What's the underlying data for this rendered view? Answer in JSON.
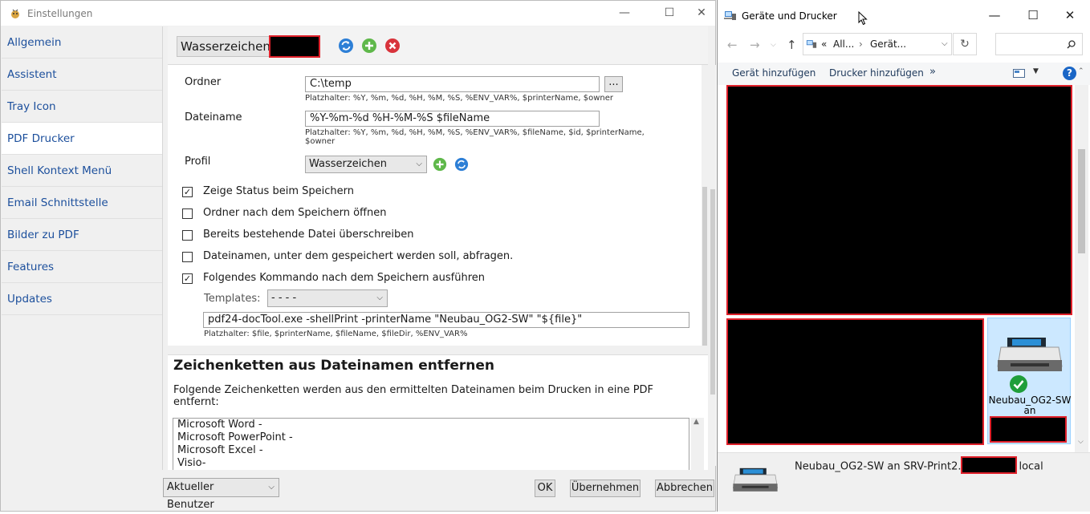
{
  "left_window": {
    "title": "Einstellungen",
    "sidebar": [
      {
        "label": "Allgemein"
      },
      {
        "label": "Assistent"
      },
      {
        "label": "Tray Icon"
      },
      {
        "label": "PDF Drucker",
        "active": true
      },
      {
        "label": "Shell Kontext Menü"
      },
      {
        "label": "Email Schnittstelle"
      },
      {
        "label": "Bilder zu PDF"
      },
      {
        "label": "Features"
      },
      {
        "label": "Updates"
      }
    ],
    "header": {
      "profile_name": "Wasserzeichen"
    },
    "form": {
      "folder_label": "Ordner",
      "folder_value": "C:\\temp",
      "folder_browse": "...",
      "folder_hint": "Platzhalter: %Y, %m, %d, %H, %M, %S, %ENV_VAR%, $printerName, $owner",
      "filename_label": "Dateiname",
      "filename_value": "%Y-%m-%d %H-%M-%S $fileName",
      "filename_hint_1": "Platzhalter: %Y, %m, %d, %H, %M, %S, %ENV_VAR%, $fileName, $id, $printerName,",
      "filename_hint_2": "$owner",
      "profile_label": "Profil",
      "profile_value": "Wasserzeichen",
      "checkboxes": [
        {
          "label": "Zeige Status beim Speichern",
          "checked": true
        },
        {
          "label": "Ordner nach dem Speichern öffnen",
          "checked": false
        },
        {
          "label": "Bereits bestehende Datei überschreiben",
          "checked": false
        },
        {
          "label": "Dateinamen, unter dem gespeichert werden soll, abfragen.",
          "checked": false
        },
        {
          "label": "Folgendes Kommando nach dem Speichern ausführen",
          "checked": true
        }
      ],
      "templates_label": "Templates:",
      "templates_value": "- - - -",
      "command_value": "pdf24-docTool.exe -shellPrint -printerName \"Neubau_OG2-SW\" \"${file}\"",
      "command_hint": "Platzhalter: $file, $printerName, $fileName, $fileDir, %ENV_VAR%"
    },
    "section2": {
      "title": "Zeichenketten aus Dateinamen entfernen",
      "description": "Folgende Zeichenketten werden aus den ermittelten Dateinamen beim Drucken in eine PDF entfernt:",
      "lines": [
        "Microsoft Word -",
        "Microsoft PowerPoint -",
        "Microsoft Excel -",
        "Visio-"
      ]
    },
    "footer": {
      "user_select": "Aktueller Benutzer",
      "ok": "OK",
      "apply": "Übernehmen",
      "cancel": "Abbrechen"
    }
  },
  "right_window": {
    "title": "Geräte und Drucker",
    "address": {
      "prefix": "«",
      "part1": "All...",
      "sep": "›",
      "part2": "Gerät..."
    },
    "commands": {
      "add_device": "Gerät hinzufügen",
      "add_printer": "Drucker hinzufügen",
      "more": "»"
    },
    "help": "?",
    "device": {
      "label_1": "Neubau_OG2-SW",
      "label_2": "an"
    },
    "details": {
      "text_prefix": "Neubau_OG2-SW an SRV-Print2.",
      "text_suffix": "local"
    }
  },
  "colors": {
    "accent_link": "#1c4f9c",
    "redaction_border": "#e0202a",
    "selection": "#cce8ff"
  }
}
